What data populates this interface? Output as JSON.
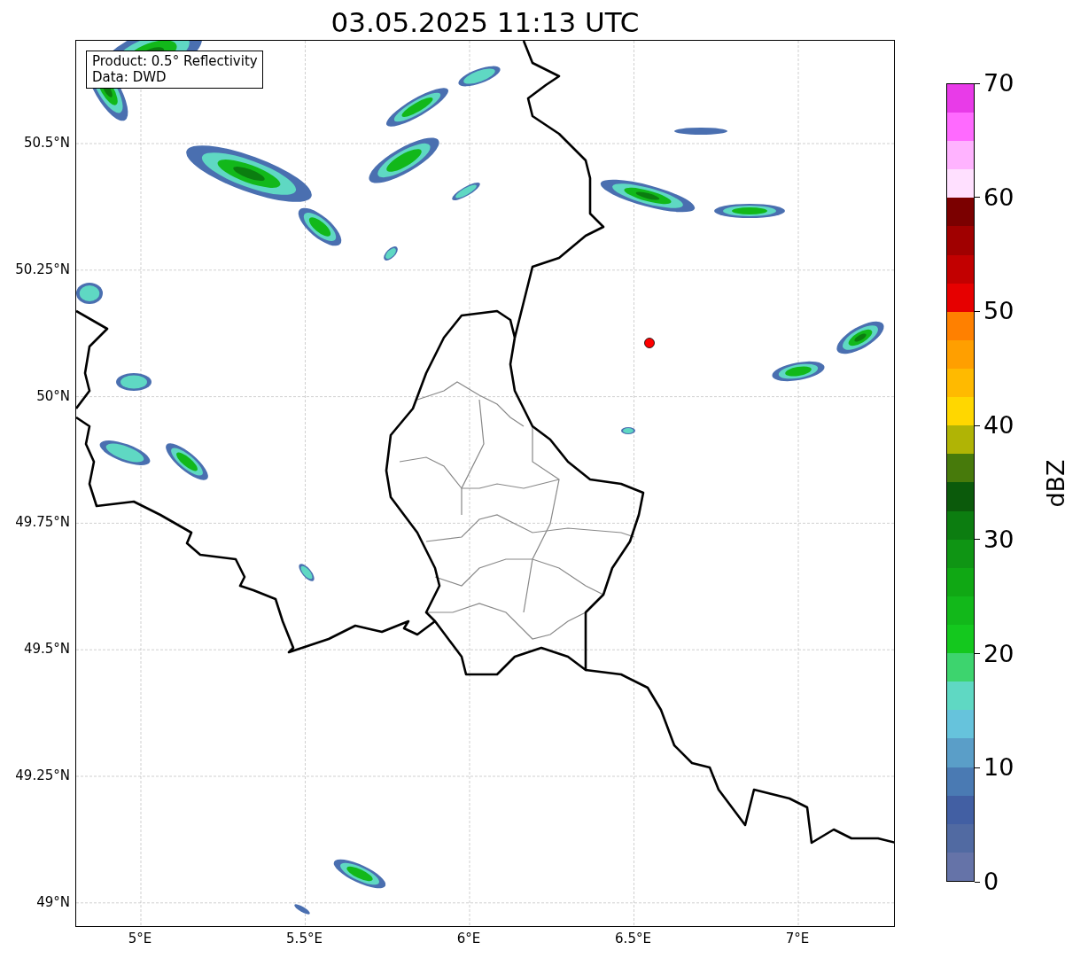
{
  "title": "03.05.2025 11:13 UTC",
  "map": {
    "info_box": [
      "Product: 0.5° Reflectivity",
      "Data: DWD"
    ],
    "lat_labels": [
      "50.5°N",
      "50.25°N",
      "50°N",
      "49.75°N",
      "49.5°N",
      "49.25°N",
      "49°N"
    ],
    "lon_labels": [
      "5°E",
      "5.5°E",
      "6°E",
      "6.5°E",
      "7°E"
    ]
  },
  "colorbar": {
    "label": "dBZ",
    "ticks": [
      "70",
      "60",
      "50",
      "40",
      "30",
      "20",
      "10",
      "0"
    ],
    "segments": [
      {
        "color": "#6573a8"
      },
      {
        "color": "#516aa2"
      },
      {
        "color": "#425fa3"
      },
      {
        "color": "#4a7ab3"
      },
      {
        "color": "#5a9ec8"
      },
      {
        "color": "#66c3dc"
      },
      {
        "color": "#5fd8c3"
      },
      {
        "color": "#3dd46e"
      },
      {
        "color": "#14c81e"
      },
      {
        "color": "#12b81a"
      },
      {
        "color": "#10a814"
      },
      {
        "color": "#0f9514"
      },
      {
        "color": "#0c7d10"
      },
      {
        "color": "#0b5a0b"
      },
      {
        "color": "#477a0b"
      },
      {
        "color": "#b0b405"
      },
      {
        "color": "#ffd700"
      },
      {
        "color": "#ffba00"
      },
      {
        "color": "#ff9f00"
      },
      {
        "color": "#ff8000"
      },
      {
        "color": "#e60000"
      },
      {
        "color": "#c20000"
      },
      {
        "color": "#a00000"
      },
      {
        "color": "#7b0000"
      },
      {
        "color": "#ffe0ff"
      },
      {
        "color": "#ffb3ff"
      },
      {
        "color": "#ff6aff"
      },
      {
        "color": "#e83be8"
      }
    ]
  }
}
